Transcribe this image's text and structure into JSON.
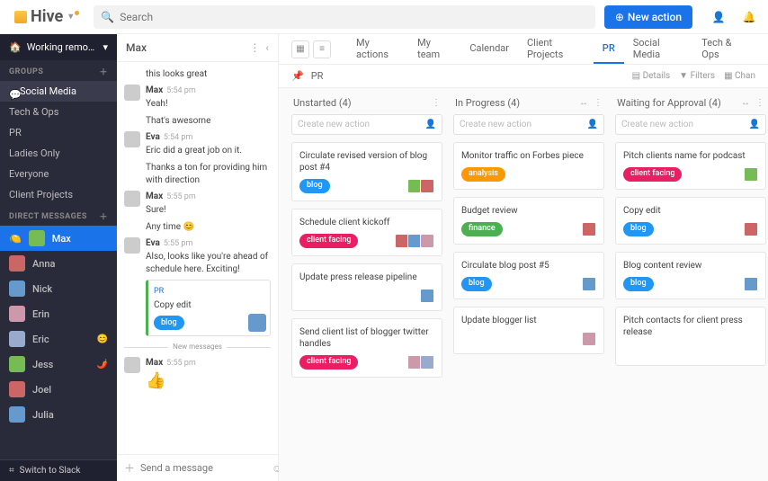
{
  "topbar": {
    "logo": "Hive",
    "search_placeholder": "Search",
    "new_action": "New action"
  },
  "sidebar": {
    "workspace": "Working remo…",
    "groups_hdr": "GROUPS",
    "groups": [
      {
        "label": "Social Media",
        "active": true,
        "icon": "💬"
      },
      {
        "label": "Tech & Ops"
      },
      {
        "label": "PR"
      },
      {
        "label": "Ladies Only"
      },
      {
        "label": "Everyone"
      },
      {
        "label": "Client Projects"
      }
    ],
    "dm_hdr": "DIRECT MESSAGES",
    "dms": [
      {
        "label": "Max",
        "active": true,
        "badge": "🍋"
      },
      {
        "label": "Anna"
      },
      {
        "label": "Nick"
      },
      {
        "label": "Erin"
      },
      {
        "label": "Eric",
        "emoji": "😊"
      },
      {
        "label": "Jess",
        "emoji": "🌶️"
      },
      {
        "label": "Joel"
      },
      {
        "label": "Julia"
      }
    ],
    "slack": "Switch to Slack"
  },
  "chat": {
    "title": "Max",
    "messages": [
      {
        "text": "this looks great",
        "indent": true
      },
      {
        "name": "Max",
        "time": "5:54 pm",
        "text": "Yeah!"
      },
      {
        "text": "That's awesome",
        "indent": true
      },
      {
        "name": "Eva",
        "time": "5:54 pm",
        "text": "Eric did a great job on it."
      },
      {
        "text": "Thanks a ton for providing him with direction",
        "indent": true
      },
      {
        "name": "Max",
        "time": "5:55 pm",
        "text": "Sure!"
      },
      {
        "text": "Any time 😊",
        "indent": true
      },
      {
        "name": "Eva",
        "time": "5:55 pm",
        "text": "Also, looks like you're ahead of schedule here. Exciting!"
      }
    ],
    "card": {
      "project": "PR",
      "title": "Copy edit",
      "badge": "blog"
    },
    "new_divider": "New messages",
    "thumb_msg": {
      "name": "Max",
      "time": "5:55 pm",
      "emoji": "👍"
    },
    "compose_placeholder": "Send a message"
  },
  "board": {
    "tabs": [
      "My actions",
      "My team",
      "Calendar",
      "Client Projects",
      "PR",
      "Social Media",
      "Tech & Ops"
    ],
    "active_tab": "PR",
    "breadcrumb": "PR",
    "tools": {
      "details": "Details",
      "filters": "Filters",
      "change": "Chan"
    },
    "lanes": [
      {
        "title": "Unstarted (4)",
        "cards": [
          {
            "title": "Circulate revised version of blog post #4",
            "badge": "blog",
            "assignees": 2
          },
          {
            "title": "Schedule client kickoff",
            "badge": "client facing",
            "assignees": 3
          },
          {
            "title": "Update press release pipeline",
            "assignees": 1
          },
          {
            "title": "Send client list of blogger twitter handles",
            "badge": "client facing",
            "assignees": 2
          }
        ]
      },
      {
        "title": "In Progress (4)",
        "cards": [
          {
            "title": "Monitor traffic on Forbes piece",
            "badge": "analysis",
            "assignees": 0
          },
          {
            "title": "Budget review",
            "badge": "finance",
            "assignees": 1
          },
          {
            "title": "Circulate blog post #5",
            "badge": "blog",
            "assignees": 1
          },
          {
            "title": "Update blogger list",
            "assignees": 1
          }
        ]
      },
      {
        "title": "Waiting for Approval (4)",
        "cards": [
          {
            "title": "Pitch clients name for podcast",
            "badge": "client facing",
            "assignees": 1
          },
          {
            "title": "Copy edit",
            "badge": "blog",
            "assignees": 1
          },
          {
            "title": "Blog content review",
            "badge": "blog",
            "assignees": 1
          },
          {
            "title": "Pitch contacts for client press release",
            "assignees": 0
          }
        ]
      }
    ],
    "create_placeholder": "Create new action"
  }
}
